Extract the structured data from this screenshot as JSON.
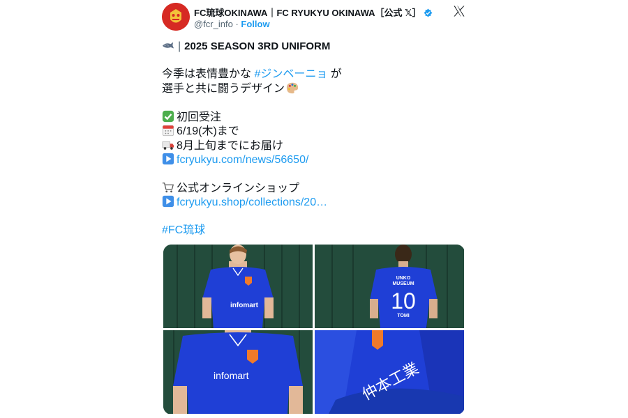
{
  "account": {
    "display_name": "FC琉球OKINAWA｜FC RYUKYU OKINAWA［公式 𝕏］",
    "handle": "@fcr_info",
    "separator": "·",
    "follow_label": "Follow",
    "verified_color": "#1d9bf0"
  },
  "post": {
    "title": "2025 SEASON 3RD UNIFORM",
    "title_divider": "|",
    "line1_prefix": "今季は表情豊かな ",
    "line1_hashtag": "#ジンベーニョ",
    "line1_suffix": " が",
    "line2": "選手と共に闘うデザイン",
    "order_heading": "初回受注",
    "deadline": "6/19(木)まで",
    "delivery": "8月上旬までにお届け",
    "news_link": "fcryukyu.com/news/56650/",
    "shop_label": "公式オンラインショップ",
    "shop_link": "fcryukyu.shop/collections/20…",
    "hashtag": "#FC琉球"
  },
  "jersey": {
    "sponsor": "infomart",
    "back_sponsor_1": "UNKO",
    "back_sponsor_2": "MUSEUM",
    "number": "10",
    "player_name": "TOMI",
    "sleeve_text": "仲本工業"
  },
  "colors": {
    "link": "#1d9bf0",
    "jersey_blue": "#1f3fd6",
    "background_green": "#1f4a3a"
  }
}
